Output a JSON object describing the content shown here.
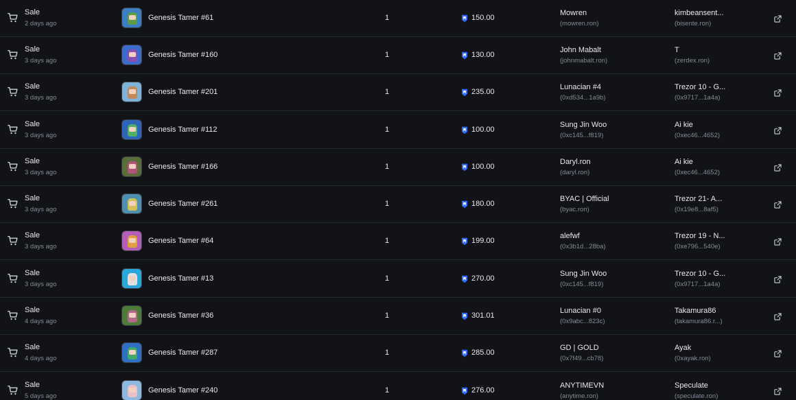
{
  "activity": {
    "rows": [
      {
        "event": "Sale",
        "time": "2 days ago",
        "name": "Genesis Tamer #61",
        "qty": "1",
        "price": "150.00",
        "from_name": "Mowren",
        "from_addr": "(mowren.ron)",
        "to_name": "kimbeansent...",
        "to_addr": "(bisente.ron)",
        "thumb_bg": "#3b7fc2",
        "thumb_char": "#5a9e4a"
      },
      {
        "event": "Sale",
        "time": "3 days ago",
        "name": "Genesis Tamer #160",
        "qty": "1",
        "price": "130.00",
        "from_name": "John Mabalt",
        "from_addr": "(johnmabalt.ron)",
        "to_name": "T",
        "to_addr": "(zerdex.ron)",
        "thumb_bg": "#3c6bc9",
        "thumb_char": "#8a4fb0"
      },
      {
        "event": "Sale",
        "time": "3 days ago",
        "name": "Genesis Tamer #201",
        "qty": "1",
        "price": "235.00",
        "from_name": "Lunacian #4",
        "from_addr": "(0xd534...1a9b)",
        "to_name": "Trezor 10 - G...",
        "to_addr": "(0x9717...1a4a)",
        "thumb_bg": "#7fb4d8",
        "thumb_char": "#c08a5a"
      },
      {
        "event": "Sale",
        "time": "3 days ago",
        "name": "Genesis Tamer #112",
        "qty": "1",
        "price": "100.00",
        "from_name": "Sung Jin Woo",
        "from_addr": "(0xc145...f819)",
        "to_name": "Ai kie",
        "to_addr": "(0xec46...4652)",
        "thumb_bg": "#2f64b8",
        "thumb_char": "#4fb06a"
      },
      {
        "event": "Sale",
        "time": "3 days ago",
        "name": "Genesis Tamer #166",
        "qty": "1",
        "price": "100.00",
        "from_name": "Daryl.ron",
        "from_addr": "(daryl.ron)",
        "to_name": "Ai kie",
        "to_addr": "(0xec46...4652)",
        "thumb_bg": "#5b6e3a",
        "thumb_char": "#b0557a"
      },
      {
        "event": "Sale",
        "time": "3 days ago",
        "name": "Genesis Tamer #261",
        "qty": "1",
        "price": "180.00",
        "from_name": "BYAC | Official",
        "from_addr": "(byac.ron)",
        "to_name": "Trezor 21- A...",
        "to_addr": "(0x19e8...8af5)",
        "thumb_bg": "#4e8fb0",
        "thumb_char": "#d0c05a"
      },
      {
        "event": "Sale",
        "time": "3 days ago",
        "name": "Genesis Tamer #64",
        "qty": "1",
        "price": "199.00",
        "from_name": "alefwf",
        "from_addr": "(0x3b1d...28ba)",
        "to_name": "Trezor 19 - N...",
        "to_addr": "(0xe796...540e)",
        "thumb_bg": "#b35fb8",
        "thumb_char": "#e0a040"
      },
      {
        "event": "Sale",
        "time": "3 days ago",
        "name": "Genesis Tamer #13",
        "qty": "1",
        "price": "270.00",
        "from_name": "Sung Jin Woo",
        "from_addr": "(0xc145...f819)",
        "to_name": "Trezor 10 - G...",
        "to_addr": "(0x9717...1a4a)",
        "thumb_bg": "#2aa6d8",
        "thumb_char": "#e0e0e0"
      },
      {
        "event": "Sale",
        "time": "4 days ago",
        "name": "Genesis Tamer #36",
        "qty": "1",
        "price": "301.01",
        "from_name": "Lunacian #0",
        "from_addr": "(0x9abc...823c)",
        "to_name": "Takamura86",
        "to_addr": "(takamura86.r...)",
        "thumb_bg": "#4f7a3a",
        "thumb_char": "#b06a8a"
      },
      {
        "event": "Sale",
        "time": "4 days ago",
        "name": "Genesis Tamer #287",
        "qty": "1",
        "price": "285.00",
        "from_name": "GD | GOLD",
        "from_addr": "(0x7f49...cb78)",
        "to_name": "Ayak",
        "to_addr": "(0xayak.ron)",
        "thumb_bg": "#2f6fc4",
        "thumb_char": "#3fa86a"
      },
      {
        "event": "Sale",
        "time": "5 days ago",
        "name": "Genesis Tamer #240",
        "qty": "1",
        "price": "276.00",
        "from_name": "ANYTIMEVN",
        "from_addr": "(anytime.ron)",
        "to_name": "Speculate",
        "to_addr": "(speculate.ron)",
        "thumb_bg": "#8fb8e0",
        "thumb_char": "#e7c0c8"
      }
    ]
  },
  "colors": {
    "ron_blue": "#2f6bff",
    "muted": "#868a97",
    "text": "#e9eaee",
    "divider": "#24262d"
  },
  "icons": {
    "event": "cart-icon",
    "token": "ron-icon",
    "action": "external-link-icon"
  }
}
